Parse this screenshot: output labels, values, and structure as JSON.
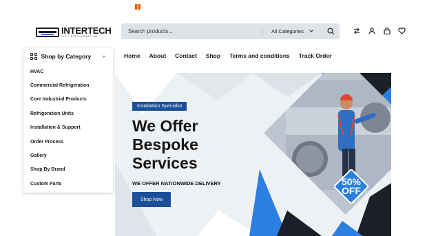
{
  "brand": {
    "name": "INTERTECH",
    "tagline": "AIR • REFRIGERATION"
  },
  "search": {
    "placeholder": "Search products...",
    "category": "All Categories"
  },
  "header_icons": [
    "compare-icon",
    "account-icon",
    "cart-icon",
    "wishlist-icon"
  ],
  "category_menu": {
    "title": "Shop by Category",
    "items": [
      "HVAC",
      "Commercial Refrigeration",
      "Core Industrial Products",
      "Refrigeration Units",
      "Installation & Support",
      "Order Process",
      "Gallery",
      "Shop By Brand",
      "Custom Parts"
    ]
  },
  "nav": [
    "Home",
    "About",
    "Contact",
    "Shop",
    "Terms and conditions",
    "Track Order"
  ],
  "hero": {
    "tag": "Installation Specialist",
    "title_lines": [
      "We Offer",
      "Bespoke",
      "Services"
    ],
    "subtitle": "WE OFFER NATIONWIDE DELIVERY",
    "cta": "Shop Now",
    "badge_line1": "50%",
    "badge_line2": "OFF"
  },
  "colors": {
    "primary": "#1b4f99",
    "accent": "#2b7fe0",
    "search_bg": "#dfe3e8"
  }
}
